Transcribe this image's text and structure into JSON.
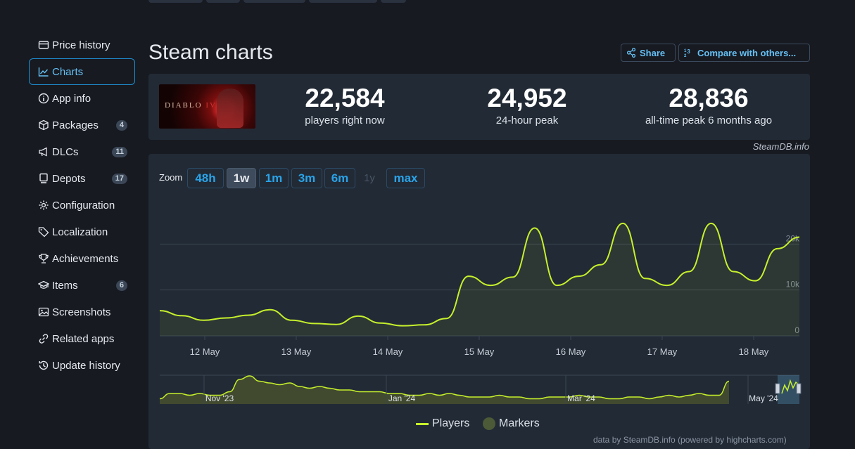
{
  "sidebar": {
    "items": [
      {
        "label": "Price history",
        "icon": "price-tag-card-icon"
      },
      {
        "label": "Charts",
        "icon": "line-chart-icon",
        "active": true
      },
      {
        "label": "App info",
        "icon": "info-icon"
      },
      {
        "label": "Packages",
        "icon": "package-icon",
        "badge": "4"
      },
      {
        "label": "DLCs",
        "icon": "megaphone-icon",
        "badge": "11"
      },
      {
        "label": "Depots",
        "icon": "depot-icon",
        "badge": "17"
      },
      {
        "label": "Configuration",
        "icon": "gear-icon"
      },
      {
        "label": "Localization",
        "icon": "tag-icon"
      },
      {
        "label": "Achievements",
        "icon": "trophy-icon"
      },
      {
        "label": "Items",
        "icon": "graduation-cap-icon",
        "badge": "6"
      },
      {
        "label": "Screenshots",
        "icon": "image-icon"
      },
      {
        "label": "Related apps",
        "icon": "link-icon"
      },
      {
        "label": "Update history",
        "icon": "history-icon"
      }
    ]
  },
  "header": {
    "title": "Steam charts",
    "share_label": "Share",
    "compare_label": "Compare with others..."
  },
  "game": {
    "capsule_logo": "DIABLO",
    "capsule_numeral": "IV"
  },
  "stats": {
    "current": {
      "value": "22,584",
      "label": "players right now"
    },
    "peak24": {
      "value": "24,952",
      "label": "24-hour peak"
    },
    "alltime": {
      "value": "28,836",
      "label": "all-time peak 6 months ago"
    }
  },
  "credit_top": "SteamDB.info",
  "zoom": {
    "label": "Zoom",
    "options": [
      {
        "label": "48h"
      },
      {
        "label": "1w",
        "active": true
      },
      {
        "label": "1m"
      },
      {
        "label": "3m"
      },
      {
        "label": "6m"
      },
      {
        "label": "1y",
        "disabled": true
      },
      {
        "label": "max"
      }
    ]
  },
  "legend": {
    "players": "Players",
    "markers": "Markers"
  },
  "footer_credit": "data by SteamDB.info (powered by highcharts.com)",
  "colors": {
    "line": "#c6f02c",
    "accent": "#66c0f4",
    "panel": "#222a35",
    "background": "#171a21"
  },
  "chart_data": [
    {
      "type": "line",
      "title": "",
      "series": [
        {
          "name": "Players",
          "values_ref": "x/y"
        }
      ],
      "x": [
        "11 May 12:00",
        "11 May 18:00",
        "12 May 00:00",
        "12 May 06:00",
        "12 May 12:00",
        "12 May 18:00",
        "13 May 00:00",
        "13 May 06:00",
        "13 May 12:00",
        "13 May 18:00",
        "14 May 00:00",
        "14 May 06:00",
        "14 May 12:00",
        "14 May 18:00",
        "15 May 00:00",
        "15 May 06:00",
        "15 May 12:00",
        "15 May 18:00",
        "16 May 00:00",
        "16 May 06:00",
        "16 May 12:00",
        "16 May 18:00",
        "17 May 00:00",
        "17 May 06:00",
        "17 May 12:00",
        "17 May 18:00",
        "18 May 00:00",
        "18 May 06:00",
        "18 May 12:00",
        "18 May 15:00"
      ],
      "y": [
        5500,
        4400,
        3400,
        3900,
        4500,
        5700,
        3400,
        2700,
        2500,
        4300,
        2800,
        2200,
        2400,
        3800,
        13000,
        11000,
        12800,
        23500,
        11000,
        13000,
        15500,
        24500,
        12500,
        11000,
        14000,
        24500,
        14000,
        12000,
        19000,
        21500
      ],
      "xlabels": [
        "12 May",
        "13 May",
        "14 May",
        "15 May",
        "16 May",
        "17 May",
        "18 May"
      ],
      "yticks": [
        "0",
        "10k",
        "20k"
      ],
      "ylim": [
        0,
        30000
      ],
      "grid": true
    },
    {
      "type": "area",
      "series": [
        {
          "name": "Players (navigator)"
        }
      ],
      "xlabels": [
        "Nov '23",
        "Jan '24",
        "Mar '24",
        "May '24"
      ],
      "y": [
        3,
        6,
        6,
        5,
        6,
        5,
        5,
        7,
        14,
        16,
        13,
        12,
        11,
        12,
        10,
        9,
        10,
        9,
        8,
        8,
        7,
        7,
        7,
        6,
        6,
        5,
        5,
        6,
        5,
        6,
        5,
        4,
        4,
        4,
        5,
        4,
        4,
        3,
        3,
        4,
        4,
        4,
        5,
        4,
        4,
        3,
        3,
        4,
        4,
        3,
        4,
        5,
        4,
        5,
        6,
        5,
        5,
        13
      ]
    }
  ]
}
